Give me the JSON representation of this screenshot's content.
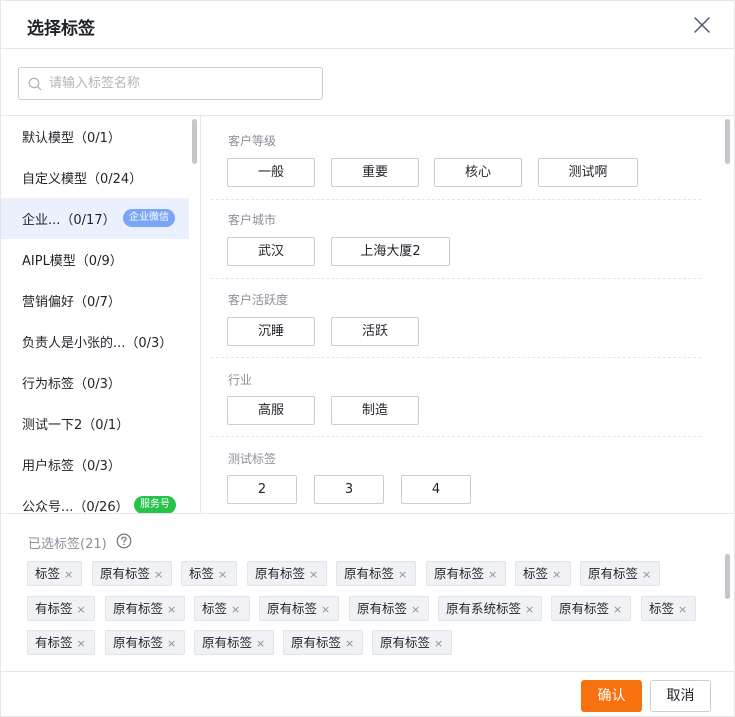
{
  "dialog": {
    "title": "选择标签"
  },
  "search": {
    "placeholder": "请输入标签名称",
    "value": ""
  },
  "categories": [
    {
      "label": "默认模型（0/1）",
      "badge": ""
    },
    {
      "label": "自定义模型（0/24）",
      "badge": ""
    },
    {
      "label": "企业...（0/17）",
      "badge": "企业微信"
    },
    {
      "label": "AIPL模型（0/9）",
      "badge": ""
    },
    {
      "label": "营销偏好（0/7）",
      "badge": ""
    },
    {
      "label": "负责人是小张的...（0/3）",
      "badge": ""
    },
    {
      "label": "行为标签（0/3）",
      "badge": ""
    },
    {
      "label": "测试一下2（0/1）",
      "badge": ""
    },
    {
      "label": "用户标签（0/3）",
      "badge": ""
    },
    {
      "label": "公众号...（0/26）",
      "badge": "服务号"
    }
  ],
  "tag_groups": [
    {
      "title": "客户等级",
      "tags": [
        "一般",
        "重要",
        "核心",
        "测试啊"
      ]
    },
    {
      "title": "客户城市",
      "tags": [
        "武汉",
        "上海大厦2"
      ]
    },
    {
      "title": "客户活跃度",
      "tags": [
        "沉睡",
        "活跃"
      ]
    },
    {
      "title": "行业",
      "tags": [
        "高服",
        "制造"
      ]
    },
    {
      "title": "测试标签",
      "tags": [
        "2",
        "3",
        "4"
      ]
    }
  ],
  "selected": {
    "title": "已选标签(21)",
    "chips": [
      "标签",
      "原有标签",
      "标签",
      "原有标签",
      "原有标签",
      "原有标签",
      "标签",
      "原有标签",
      "有标签",
      "原有标签",
      "标签",
      "原有标签",
      "原有标签",
      "原有系统标签",
      "原有标签",
      "标签",
      "有标签",
      "原有标签",
      "原有标签",
      "原有标签",
      "原有标签"
    ],
    "remove_glyph": "×"
  },
  "footer": {
    "confirm_label": "确认",
    "cancel_label": "取消"
  },
  "colors": {
    "accent": "#f7720f",
    "selected_row": "#eaf1fd",
    "badge_blue": "#7aa6f5",
    "badge_green": "#28c24b"
  },
  "icons": {
    "close": "close-icon",
    "search": "search-icon",
    "help": "help-circle-icon"
  }
}
